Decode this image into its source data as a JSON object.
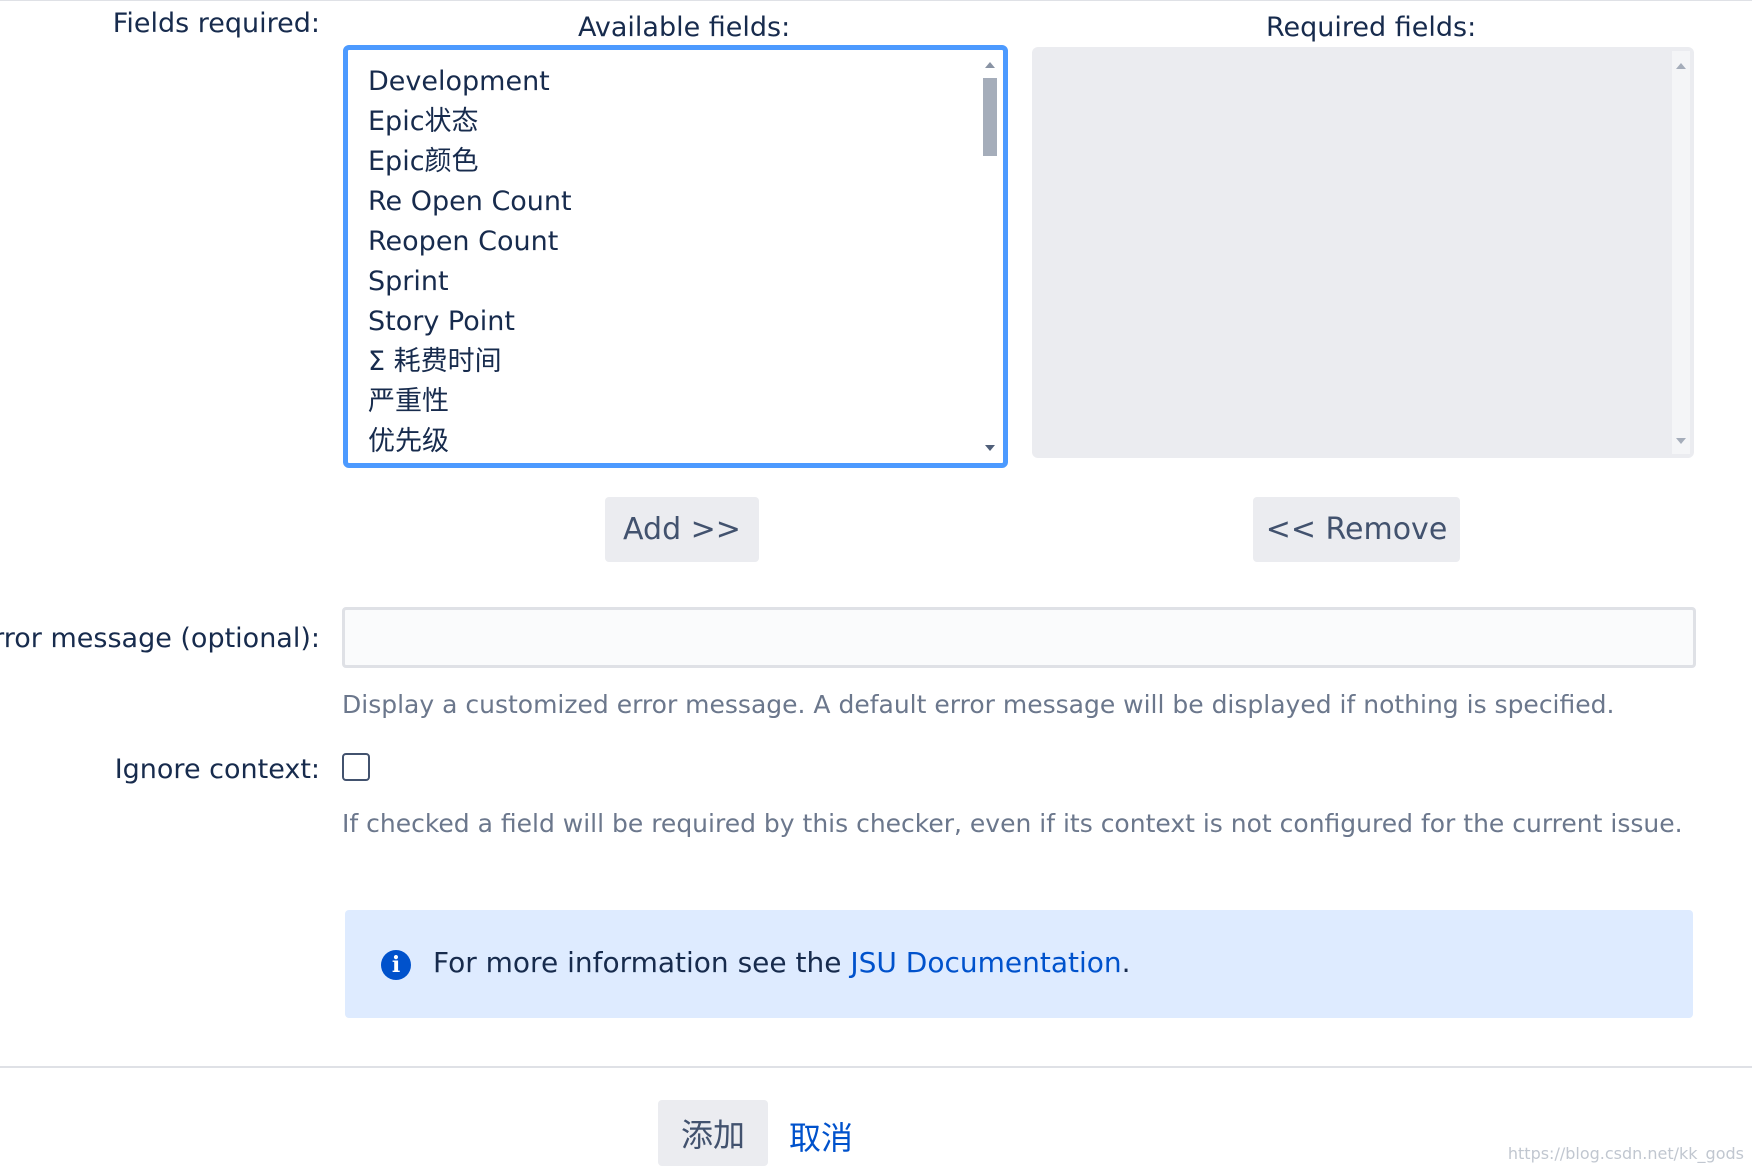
{
  "fields_required": {
    "label": "Fields required:",
    "available_header": "Available fields:",
    "required_header": "Required fields:",
    "available_items": [
      "Development",
      "Epic状态",
      "Epic颜色",
      "Re Open Count",
      "Reopen Count",
      "Sprint",
      "Story Point",
      "Σ 耗费时间",
      "严重性",
      "优先级"
    ],
    "required_items": [],
    "add_button": "Add >>",
    "remove_button": "<< Remove"
  },
  "error_message": {
    "label": "Error message (optional):",
    "value": "",
    "help": "Display a customized error message. A default error message will be displayed if nothing is specified."
  },
  "ignore_context": {
    "label": "Ignore context:",
    "checked": false,
    "help": "If checked a field will be required by this checker, even if its context is not configured for the current issue."
  },
  "info": {
    "prefix": "For more information see the ",
    "link_text": "JSU Documentation",
    "suffix": "."
  },
  "footer": {
    "submit": "添加",
    "cancel": "取消"
  },
  "watermark": "https://blog.csdn.net/kk_gods",
  "colors": {
    "focus_border": "#4c9aff",
    "link": "#0052cc",
    "info_bg": "#deebff",
    "button_bg": "#ebecf0"
  }
}
